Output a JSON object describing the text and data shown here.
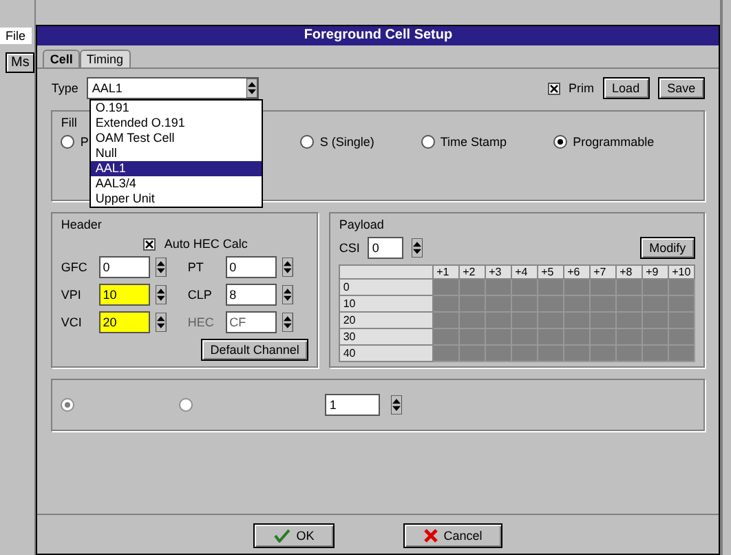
{
  "background_app": {
    "menu": "File",
    "button": "Ms"
  },
  "window": {
    "title": "Foreground Cell Setup"
  },
  "tabs": [
    {
      "label": "Cell",
      "selected": true
    },
    {
      "label": "Timing",
      "selected": false
    }
  ],
  "type": {
    "label": "Type",
    "value": "AAL1",
    "options": [
      {
        "label": "O.191",
        "selected": false
      },
      {
        "label": "Extended O.191",
        "selected": false
      },
      {
        "label": "OAM Test Cell",
        "selected": false
      },
      {
        "label": "Null",
        "selected": false
      },
      {
        "label": "AAL1",
        "selected": true
      },
      {
        "label": "AAL3/4",
        "selected": false
      },
      {
        "label": "Upper Unit",
        "selected": false
      }
    ]
  },
  "prim": {
    "label": "Prim",
    "checked": true
  },
  "top_buttons": [
    "Load",
    "Save"
  ],
  "filler": {
    "title": "Fill",
    "options": [
      {
        "label": "P",
        "selected": false
      },
      {
        "label": "S (Single)",
        "selected": false
      },
      {
        "label": "Time Stamp",
        "selected": false
      },
      {
        "label": "Programmable",
        "selected": true
      }
    ]
  },
  "header": {
    "title": "Header",
    "auto_hec": {
      "label": "Auto HEC Calc",
      "checked": true
    },
    "fields": [
      {
        "label": "GFC",
        "value": "0",
        "highlighted": false,
        "disabled": false
      },
      {
        "label": "PT",
        "value": "0",
        "highlighted": false,
        "disabled": false
      },
      {
        "label": "VPI",
        "value": "10",
        "highlighted": true,
        "disabled": false
      },
      {
        "label": "CLP",
        "value": "8",
        "highlighted": false,
        "disabled": false
      },
      {
        "label": "VCI",
        "value": "20",
        "highlighted": true,
        "disabled": false
      },
      {
        "label": "HEC",
        "value": "CF",
        "highlighted": false,
        "disabled": true
      }
    ],
    "button": "Default Channel"
  },
  "payload": {
    "title": "Payload",
    "csi_label": "CSI",
    "csi_value": "0",
    "button": "Modify",
    "columns": [
      "+1",
      "+2",
      "+3",
      "+4",
      "+5",
      "+6",
      "+7",
      "+8",
      "+9",
      "+10"
    ],
    "rows": [
      "0",
      "10",
      "20",
      "30",
      "40"
    ]
  },
  "cell_gap": {
    "options": [
      {
        "selected": true
      },
      {
        "selected": false
      }
    ],
    "value": "1"
  },
  "buttons": [
    {
      "label": "OK",
      "kind": "ok"
    },
    {
      "label": "Cancel",
      "kind": "cancel"
    }
  ]
}
